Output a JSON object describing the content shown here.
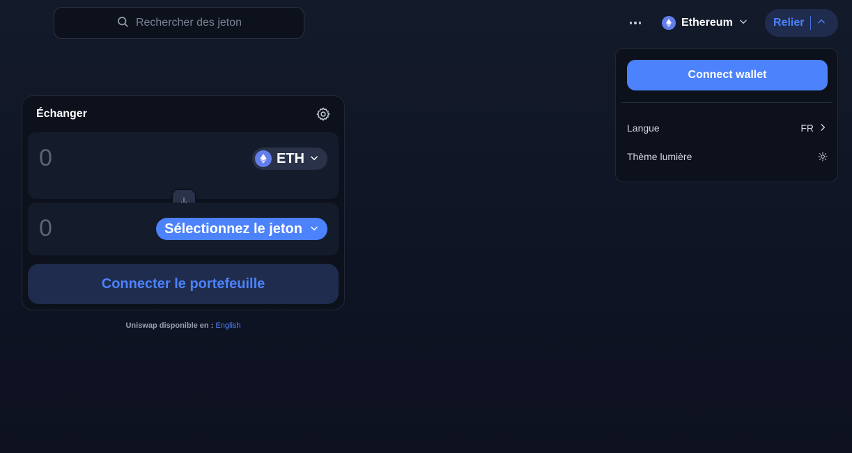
{
  "search": {
    "placeholder": "Rechercher des jeton"
  },
  "nav": {
    "network_label": "Ethereum",
    "connect_label": "Relier"
  },
  "menu": {
    "connect_wallet_label": "Connect wallet",
    "language_label": "Langue",
    "language_value": "FR",
    "theme_label": "Thème lumière"
  },
  "swap": {
    "title": "Échanger",
    "input_amount": "0",
    "input_token": "ETH",
    "output_amount": "0",
    "output_token_placeholder": "Sélectionnez le jeton",
    "connect_label": "Connecter le portefeuille"
  },
  "footer": {
    "text": "Uniswap disponible en :",
    "link": "English"
  },
  "colors": {
    "accent": "#4c82fb",
    "background": "#131a2a",
    "surface": "#0d111c",
    "panel": "#141b2b",
    "eth": "#627eea"
  },
  "icons": [
    "search-icon",
    "more-icon",
    "ethereum-icon",
    "chevron-down-icon",
    "chevron-up-icon",
    "chevron-right-icon",
    "sun-icon",
    "gear-icon",
    "arrow-down-icon"
  ]
}
